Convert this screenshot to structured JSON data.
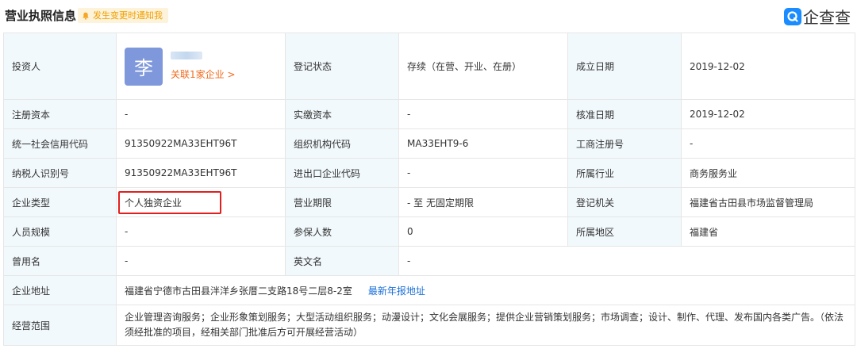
{
  "header": {
    "title": "营业执照信息",
    "notify_label": "发生变更时通知我",
    "logo_text": "企查查",
    "accent": "#1a8cff"
  },
  "investor": {
    "label": "投资人",
    "avatar_char": "李",
    "related_link": "关联1家企业 >"
  },
  "rows": {
    "reg_status_label": "登记状态",
    "reg_status_value": "存续（在营、开业、在册）",
    "founded_label": "成立日期",
    "founded_value": "2019-12-02",
    "capital_label": "注册资本",
    "capital_value": "-",
    "paid_label": "实缴资本",
    "paid_value": "-",
    "approve_label": "核准日期",
    "approve_value": "2019-12-02",
    "credit_label": "统一社会信用代码",
    "credit_value": "91350922MA33EHT96T",
    "org_label": "组织机构代码",
    "org_value": "MA33EHT9-6",
    "biz_reg_label": "工商注册号",
    "biz_reg_value": "-",
    "tax_label": "纳税人识别号",
    "tax_value": "91350922MA33EHT96T",
    "import_label": "进出口企业代码",
    "import_value": "-",
    "industry_label": "所属行业",
    "industry_value": "商务服务业",
    "type_label": "企业类型",
    "type_value": "个人独资企业",
    "term_label": "营业期限",
    "term_value": "- 至 无固定期限",
    "authority_label": "登记机关",
    "authority_value": "福建省古田县市场监督管理局",
    "staff_label": "人员规模",
    "staff_value": "-",
    "insured_label": "参保人数",
    "insured_value": "0",
    "region_label": "所属地区",
    "region_value": "福建省",
    "former_label": "曾用名",
    "former_value": "-",
    "english_label": "英文名",
    "english_value": "-",
    "address_label": "企业地址",
    "address_value": "福建省宁德市古田县泮洋乡张厝二支路18号二层8-2室",
    "address_link": "最新年报地址",
    "scope_label": "经营范围",
    "scope_value": "企业管理咨询服务；企业形象策划服务；大型活动组织服务；动漫设计；文化会展服务；提供企业营销策划服务；市场调查；设计、制作、代理、发布国内各类广告。（依法须经批准的项目，经相关部门批准后方可开展经营活动）"
  }
}
